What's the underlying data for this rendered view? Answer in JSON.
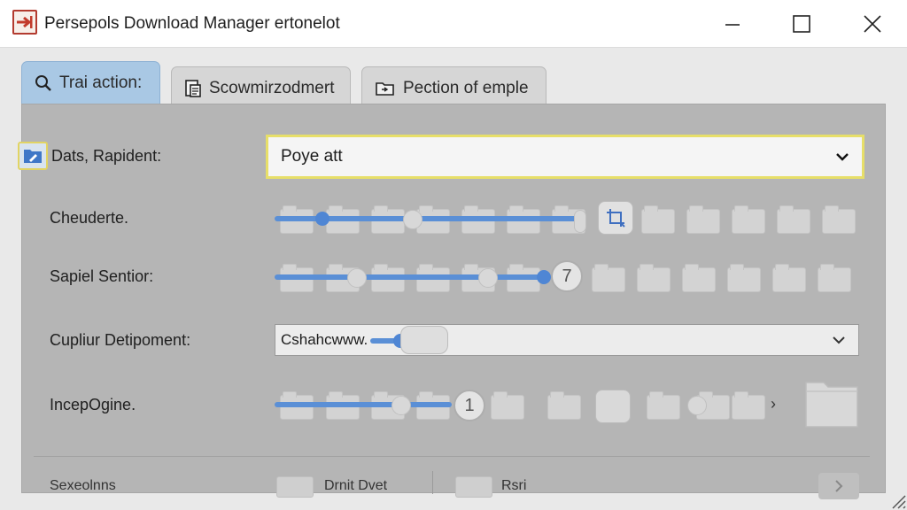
{
  "window": {
    "title": "Persepols Download Manager ertonelot"
  },
  "tabs": [
    {
      "label": "Trai action:",
      "icon": "search-icon",
      "active": true
    },
    {
      "label": "Scowmirzodmert",
      "icon": "document-icon",
      "active": false
    },
    {
      "label": "Pection of emple",
      "icon": "folder-icon",
      "active": false
    }
  ],
  "rows": {
    "row1": {
      "label": "Dats, Rapident:",
      "dropdown_value": "Poye att"
    },
    "row2": {
      "label": "Cheuderte."
    },
    "row3": {
      "label": "Sapiel Sentior:",
      "badge": "7"
    },
    "row4": {
      "label": "Cupliur Detipoment:",
      "dropdown_value": "Cshahcwww."
    },
    "row5": {
      "label": "IncepOgine.",
      "badge": "1"
    }
  },
  "bottom": {
    "label": "Sexeolnns",
    "item1": "Drnit Dvet",
    "item2": "Rsri"
  },
  "colors": {
    "accent_blue": "#5a8fd6",
    "active_tab": "#a9c8e4",
    "focus_yellow": "#e7df69",
    "panel_bg": "#b5b5b5"
  }
}
